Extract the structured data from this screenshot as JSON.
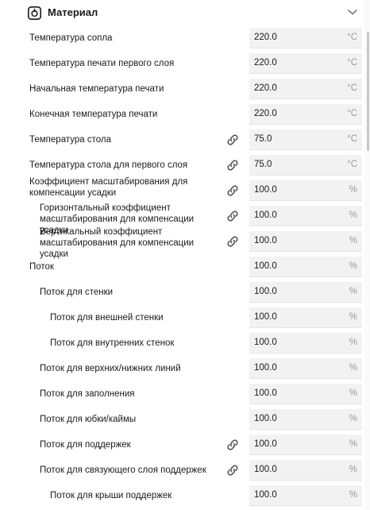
{
  "section": {
    "title": "Материал",
    "icon": "spool-icon",
    "toggle_icon": "chevron-down-icon"
  },
  "rows": [
    {
      "label": "Температура сопла",
      "value": "220.0",
      "unit": "°C",
      "linked": false
    },
    {
      "label": "Температура печати первого слоя",
      "value": "220.0",
      "unit": "°C",
      "linked": false
    },
    {
      "label": "Начальная температура печати",
      "value": "220.0",
      "unit": "°C",
      "linked": false
    },
    {
      "label": "Конечная температура печати",
      "value": "220.0",
      "unit": "°C",
      "linked": false
    },
    {
      "label": "Температура стола",
      "value": "75.0",
      "unit": "°C",
      "linked": true
    },
    {
      "label": "Температура стола для первого слоя",
      "value": "75.0",
      "unit": "°C",
      "linked": true
    },
    {
      "label": "Коэффициент масштабирования для компенсации усадки",
      "value": "100.0",
      "unit": "%",
      "linked": true
    },
    {
      "label": "Горизонтальный коэффициент масштабирования для компенсации усадки",
      "value": "100.0",
      "unit": "%",
      "linked": true
    },
    {
      "label": "Вертикальный коэффициент масштабирования для компенсации усадки",
      "value": "100.0",
      "unit": "%",
      "linked": true
    },
    {
      "label": "Поток",
      "value": "100.0",
      "unit": "%",
      "linked": false
    },
    {
      "label": "Поток для стенки",
      "value": "100.0",
      "unit": "%",
      "linked": false
    },
    {
      "label": "Поток для внешней стенки",
      "value": "100.0",
      "unit": "%",
      "linked": false
    },
    {
      "label": "Поток для внутренних стенок",
      "value": "100.0",
      "unit": "%",
      "linked": false
    },
    {
      "label": "Поток для верхних/нижних линий",
      "value": "100.0",
      "unit": "%",
      "linked": false
    },
    {
      "label": "Поток для заполнения",
      "value": "100.0",
      "unit": "%",
      "linked": false
    },
    {
      "label": "Поток для юбки/каймы",
      "value": "100.0",
      "unit": "%",
      "linked": false
    },
    {
      "label": "Поток для поддержек",
      "value": "100.0",
      "unit": "%",
      "linked": true
    },
    {
      "label": "Поток для связующего слоя поддержек",
      "value": "100.0",
      "unit": "%",
      "linked": true
    },
    {
      "label": "Поток для крыши поддержек",
      "value": "100.0",
      "unit": "%",
      "linked": false
    }
  ]
}
